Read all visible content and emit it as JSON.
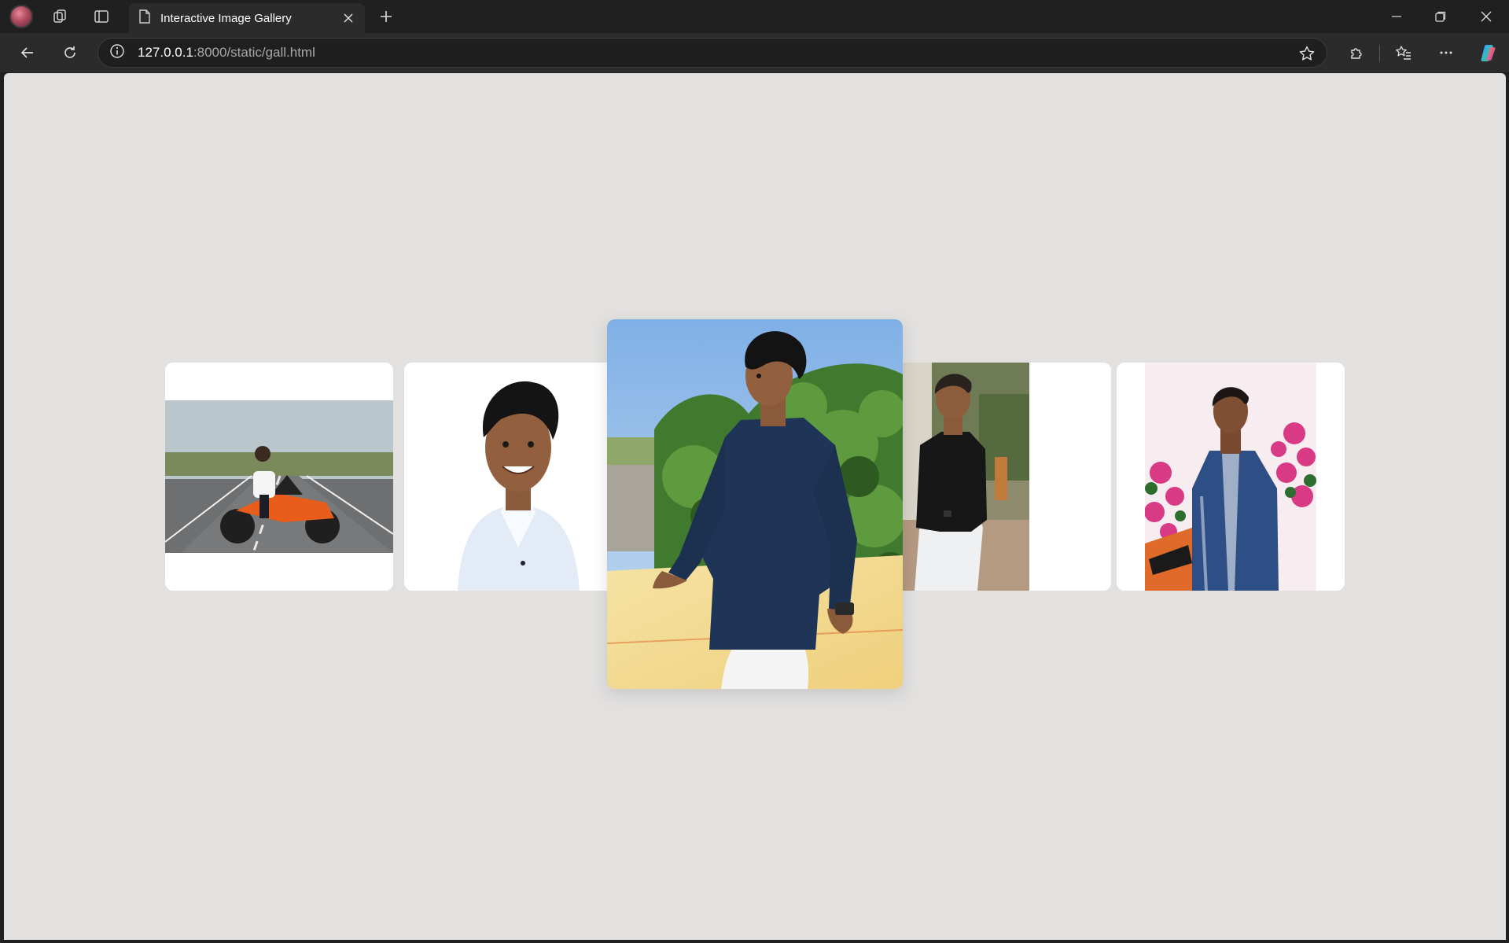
{
  "browser": {
    "tab_title": "Interactive Image Gallery",
    "url_host": "127.0.0.1",
    "url_rest": ":8000/static/gall.html",
    "icons": {
      "profile": "profile-avatar",
      "workspaces": "workspaces-icon",
      "tab_actions": "tab-actions-icon",
      "page": "page-icon",
      "close": "close-icon",
      "new_tab": "plus-icon",
      "back": "back-arrow-icon",
      "refresh": "refresh-icon",
      "site_info": "info-icon",
      "favorite": "star-icon",
      "extensions": "puzzle-icon",
      "favorites": "favorites-icon",
      "more": "more-icon",
      "copilot": "copilot-icon",
      "minimize": "minimize-icon",
      "restore": "restore-icon",
      "window_close": "window-close-icon"
    }
  },
  "gallery": {
    "background": "#e2e1e0",
    "active_index": 2,
    "images": [
      {
        "subject": "man sitting on orange motorcycle on road",
        "sky": "#b9c6cc",
        "ground": "#6d6f70",
        "accent": "#e85d1a"
      },
      {
        "subject": "smiling man in white shirt portrait",
        "sky": "#ffffff",
        "ground": "#dfe8f2",
        "accent": "#1b1b1b"
      },
      {
        "subject": "man in navy shirt leaning on wall with greenery",
        "sky": "#8fb7e3",
        "ground": "#f0d98f",
        "accent": "#1f3557"
      },
      {
        "subject": "man in black shirt standing outdoors",
        "sky": "#8a8f6a",
        "ground": "#b59a82",
        "accent": "#171717"
      },
      {
        "subject": "man in blue embroidered shirt with pink flowers",
        "sky": "#f7ecef",
        "ground": "#2d6e2f",
        "accent": "#2e4f86"
      }
    ]
  }
}
